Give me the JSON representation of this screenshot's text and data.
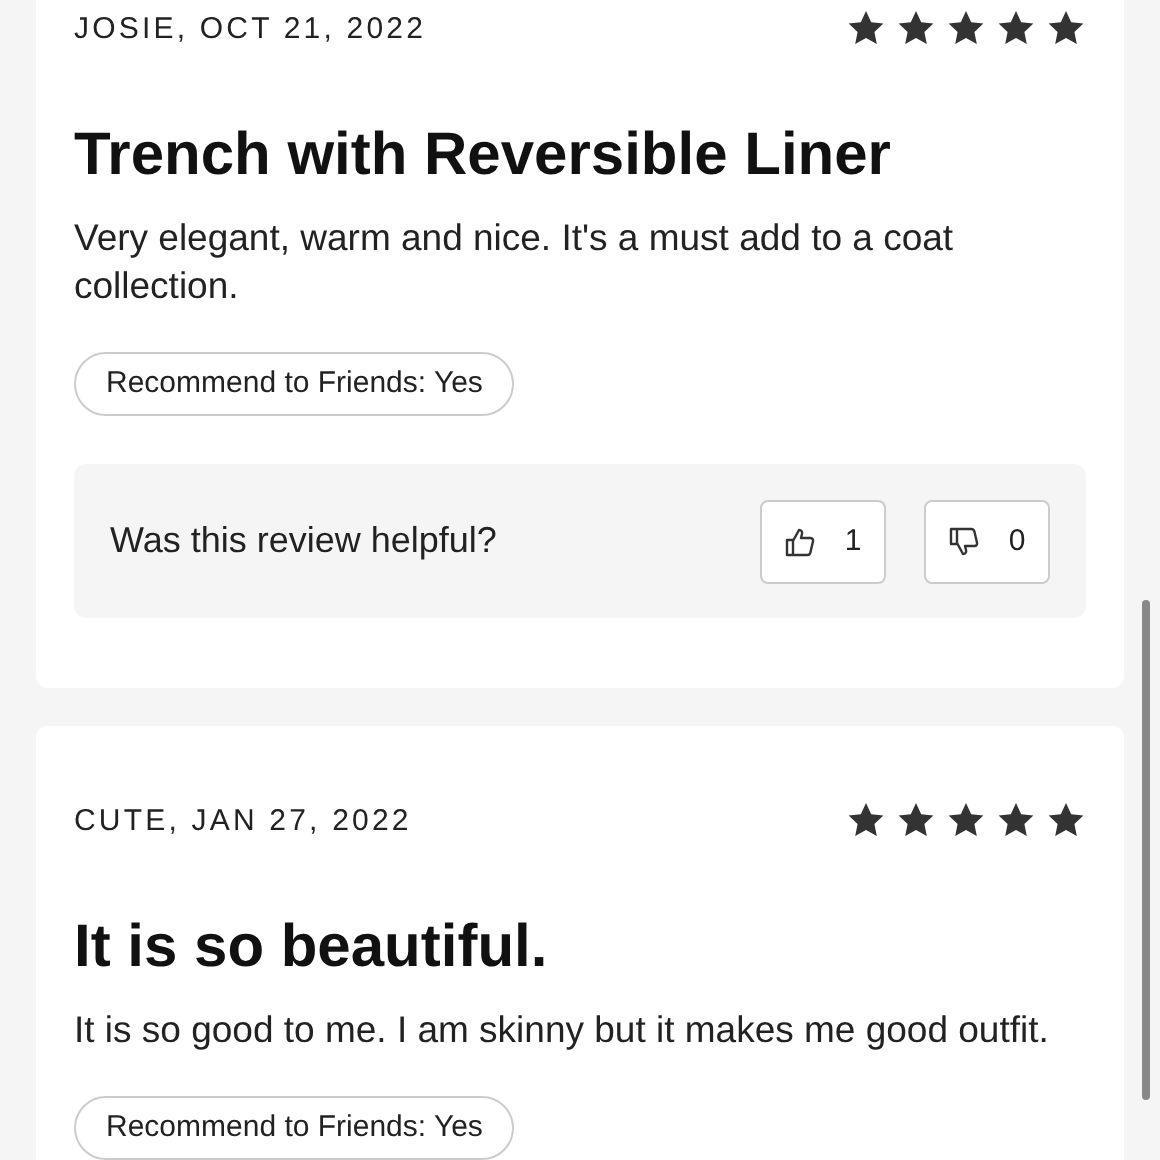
{
  "reviews": [
    {
      "byline": "JOSIE, OCT 21, 2022",
      "stars": 5,
      "title": "Trench with Reversible Liner",
      "body": "Very elegant, warm and nice. It's a must add to a coat collection.",
      "recommend": "Recommend to Friends: Yes",
      "helpful": {
        "question": "Was this review helpful?",
        "up_count": "1",
        "down_count": "0"
      }
    },
    {
      "byline": "CUTE, JAN 27, 2022",
      "stars": 5,
      "title": "It is so beautiful.",
      "body": "It is so good to me. I am skinny but it makes me good outfit.",
      "recommend": "Recommend to Friends: Yes"
    }
  ]
}
